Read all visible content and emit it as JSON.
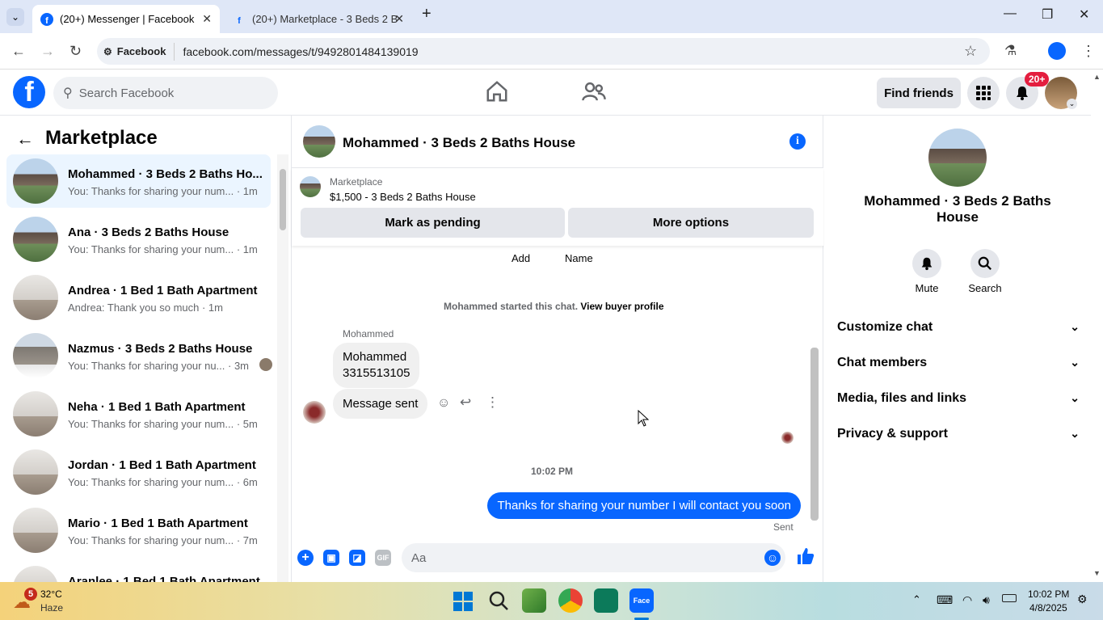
{
  "browser": {
    "tabs": [
      {
        "label": "(20+) Messenger | Facebook"
      },
      {
        "label": "(20+) Marketplace - 3 Beds 2 B"
      }
    ],
    "site_chip": "Facebook",
    "url": "facebook.com/messages/t/9492801484139019"
  },
  "fb_header": {
    "search_placeholder": "Search Facebook",
    "find_friends": "Find friends",
    "notification_badge": "20+"
  },
  "left_panel": {
    "title": "Marketplace",
    "conversations": [
      {
        "title": "Mohammed · 3 Beds 2 Baths Ho...",
        "snippet": "You: Thanks for sharing your num... · 1m",
        "selected": true
      },
      {
        "title": "Ana · 3 Beds 2 Baths House",
        "snippet": "You: Thanks for sharing your num... · 1m"
      },
      {
        "title": "Andrea · 1 Bed 1 Bath Apartment",
        "snippet": "Andrea: Thank you so much · 1m"
      },
      {
        "title": "Nazmus · 3 Beds 2 Baths House",
        "snippet": "You: Thanks for sharing your nu... · 3m"
      },
      {
        "title": "Neha · 1 Bed 1 Bath Apartment",
        "snippet": "You: Thanks for sharing your num... · 5m"
      },
      {
        "title": "Jordan · 1 Bed 1 Bath Apartment",
        "snippet": "You: Thanks for sharing your num... · 6m"
      },
      {
        "title": "Mario · 1 Bed 1 Bath Apartment",
        "snippet": "You: Thanks for sharing your num... · 7m"
      },
      {
        "title": "Aranlee · 1 Bed 1 Bath Apartment",
        "snippet": ""
      }
    ]
  },
  "chat": {
    "title": "Mohammed · 3 Beds 2 Baths House",
    "marketplace_label": "Marketplace",
    "listing": "$1,500 - 3 Beds 2 Baths House",
    "pending_button": "Mark as pending",
    "more_options_button": "More options",
    "quick_add": "Add",
    "quick_name": "Name",
    "started_text": "Mohammed started this chat.",
    "view_profile": "View buyer profile",
    "sender_name": "Mohammed",
    "msg1_line1": "Mohammed",
    "msg1_line2": "3315513105",
    "msg2": "Message sent",
    "timestamp": "10:02 PM",
    "my_message": "Thanks for sharing your number I will contact you soon",
    "sent_status": "Sent",
    "composer_placeholder": "Aa"
  },
  "right_panel": {
    "name": "Mohammed · 3 Beds 2 Baths House",
    "mute": "Mute",
    "search": "Search",
    "sections": [
      "Customize chat",
      "Chat members",
      "Media, files and links",
      "Privacy & support"
    ]
  },
  "taskbar": {
    "weather_badge": "5",
    "temperature": "32°C",
    "weather": "Haze",
    "time": "10:02 PM",
    "date": "4/8/2025"
  },
  "colors": {
    "fb_blue": "#0866ff",
    "badge_red": "#e41e3f",
    "selected_bg": "#ebf5ff"
  }
}
